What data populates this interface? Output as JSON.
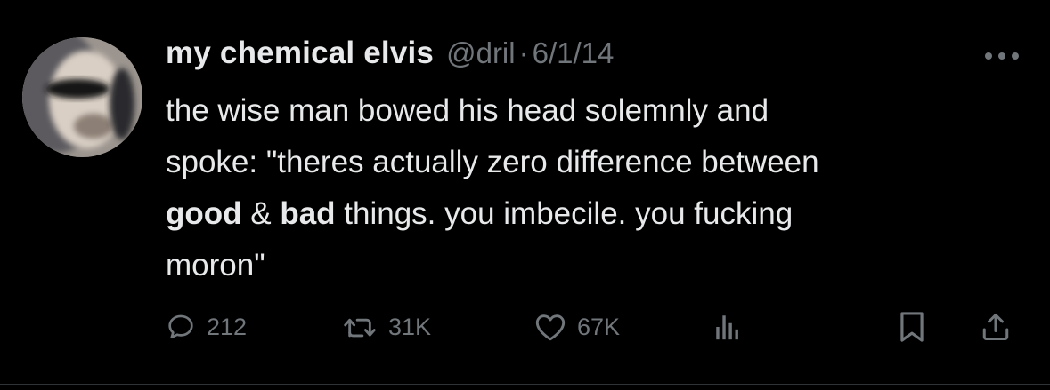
{
  "tweet": {
    "display_name": "my chemical elvis",
    "handle": "@dril",
    "separator": "·",
    "date": "6/1/14",
    "body": {
      "line1": "the wise man bowed his head solemnly and",
      "line2": "spoke: \"theres actually zero difference between",
      "line3_bold1": "good",
      "line3_mid": " & ",
      "line3_bold2": "bad",
      "line3_rest": " things. you imbecile. you fucking",
      "line4": "moron\""
    }
  },
  "actions": {
    "reply_count": "212",
    "retweet_count": "31K",
    "like_count": "67K"
  },
  "icons": {
    "more": "more-horizontal-icon",
    "reply": "reply-icon",
    "retweet": "retweet-icon",
    "like": "heart-icon",
    "views": "views-bar-chart-icon",
    "bookmark": "bookmark-icon",
    "share": "share-icon"
  },
  "colors": {
    "background": "#000000",
    "text": "#e7e9ea",
    "secondary": "#71767b"
  }
}
